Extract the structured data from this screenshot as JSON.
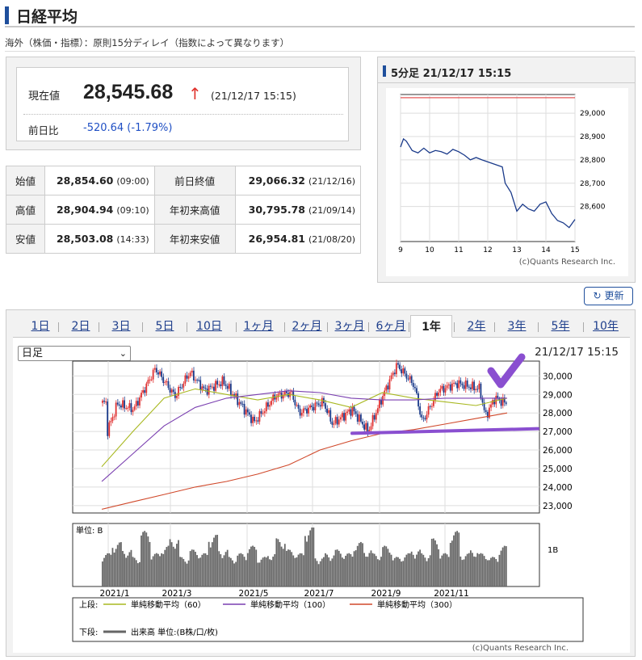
{
  "title": "日経平均",
  "note": "海外（株価・指標）：原則15分ディレイ（指数によって異なります）",
  "current": {
    "label": "現在値",
    "price": "28,545.68",
    "arrow": "↑",
    "time": "(21/12/17 15:15)",
    "change_label": "前日比",
    "change": "-520.64 (-1.79%)"
  },
  "ohlc": {
    "rows": [
      {
        "label": "始値",
        "value": "28,854.60",
        "time": "(09:00)",
        "label2": "前日終値",
        "value2": "29,066.32",
        "time2": "(21/12/16)"
      },
      {
        "label": "高値",
        "value": "28,904.94",
        "time": "(09:10)",
        "label2": "年初来高値",
        "value2": "30,795.78",
        "time2": "(21/09/14)"
      },
      {
        "label": "安値",
        "value": "28,503.08",
        "time": "(14:33)",
        "label2": "年初来安値",
        "value2": "26,954.81",
        "time2": "(21/08/20)"
      }
    ]
  },
  "intraday": {
    "header": "5分足 21/12/17 15:15",
    "copyright": "(c)Quants Research Inc."
  },
  "refresh_label": "更新",
  "tabs": [
    "1日",
    "2日",
    "3日",
    "5日",
    "10日",
    "1ヶ月",
    "2ヶ月",
    "3ヶ月",
    "6ヶ月",
    "1年",
    "2年",
    "3年",
    "5年",
    "10年"
  ],
  "active_tab": "1年",
  "daily": {
    "select_value": "日足",
    "datetime": "21/12/17 15:15",
    "volume_unit": "単位: B",
    "volume_tick": "1B",
    "legend": {
      "upper_label": "上段:",
      "lower_label": "下段:",
      "ma60": "単純移動平均（60）",
      "ma100": "単純移動平均（100）",
      "ma300": "単純移動平均（300）",
      "volume": "出来高 単位:(B株/口/枚)"
    },
    "copyright": "(c)Quants Research Inc."
  },
  "chart_data": [
    {
      "type": "line",
      "title": "5分足 21/12/17 15:15",
      "x_ticks": [
        "9",
        "10",
        "11",
        "12",
        "13",
        "14",
        "15"
      ],
      "y_ticks": [
        29000,
        28900,
        28800,
        28700,
        28600
      ],
      "ylim": [
        28450,
        29080
      ],
      "reference_line": 29066.32,
      "series": [
        {
          "x": [
            9.0,
            9.1,
            9.2,
            9.4,
            9.6,
            9.8,
            10.0,
            10.2,
            10.4,
            10.6,
            10.8,
            11.0,
            11.2,
            11.4,
            11.6,
            11.8,
            12.5,
            12.6,
            12.8,
            13.0,
            13.2,
            13.4,
            13.6,
            13.8,
            14.0,
            14.2,
            14.4,
            14.6,
            14.8,
            15.0
          ],
          "y": [
            28855,
            28890,
            28880,
            28840,
            28830,
            28850,
            28830,
            28840,
            28835,
            28825,
            28845,
            28835,
            28820,
            28800,
            28810,
            28800,
            28770,
            28700,
            28660,
            28580,
            28610,
            28590,
            28580,
            28610,
            28620,
            28570,
            28540,
            28530,
            28510,
            28545
          ]
        }
      ]
    },
    {
      "type": "candlestick",
      "title": "",
      "x_ticks": [
        "2021/1",
        "2021/3",
        "2021/5",
        "2021/7",
        "2021/9",
        "2021/11"
      ],
      "y_ticks": [
        30000,
        29000,
        28000,
        27000,
        26000,
        25000,
        24000,
        23000
      ],
      "ylim": [
        22600,
        30800
      ],
      "close_points": [
        {
          "date": "2021/1/4",
          "close": 26800
        },
        {
          "date": "2021/1/14",
          "close": 28500
        },
        {
          "date": "2021/1/28",
          "close": 28200
        },
        {
          "date": "2021/2/16",
          "close": 30400
        },
        {
          "date": "2021/3/5",
          "close": 28900
        },
        {
          "date": "2021/3/18",
          "close": 30200
        },
        {
          "date": "2021/3/31",
          "close": 29200
        },
        {
          "date": "2021/4/16",
          "close": 29700
        },
        {
          "date": "2021/5/13",
          "close": 27500
        },
        {
          "date": "2021/5/31",
          "close": 28900
        },
        {
          "date": "2021/6/14",
          "close": 29100
        },
        {
          "date": "2021/6/21",
          "close": 28000
        },
        {
          "date": "2021/7/12",
          "close": 28600
        },
        {
          "date": "2021/7/20",
          "close": 27400
        },
        {
          "date": "2021/8/6",
          "close": 28200
        },
        {
          "date": "2021/8/20",
          "close": 27000
        },
        {
          "date": "2021/9/3",
          "close": 29100
        },
        {
          "date": "2021/9/14",
          "close": 30600
        },
        {
          "date": "2021/9/29",
          "close": 29500
        },
        {
          "date": "2021/10/6",
          "close": 27500
        },
        {
          "date": "2021/10/20",
          "close": 29200
        },
        {
          "date": "2021/11/5",
          "close": 29600
        },
        {
          "date": "2021/11/25",
          "close": 29300
        },
        {
          "date": "2021/11/30",
          "close": 27800
        },
        {
          "date": "2021/12/8",
          "close": 28800
        },
        {
          "date": "2021/12/17",
          "close": 28545
        }
      ],
      "series": [
        {
          "name": "単純移動平均（60）",
          "color": "#a8b820",
          "values": [
            25100,
            27000,
            28800,
            29300,
            29000,
            28700,
            29000,
            28700,
            28300,
            29100,
            28800,
            28600,
            28400,
            28800
          ]
        },
        {
          "name": "単純移動平均（100）",
          "color": "#7a3fb0",
          "values": [
            24300,
            25800,
            27300,
            28300,
            28800,
            29000,
            29200,
            29100,
            28800,
            28700,
            28700,
            28800,
            28800,
            28800
          ]
        },
        {
          "name": "単純移動平均（300）",
          "color": "#d0482a",
          "values": [
            22800,
            23200,
            23600,
            24000,
            24300,
            24700,
            25200,
            26000,
            26500,
            26900,
            27100,
            27400,
            27700,
            28000
          ]
        }
      ]
    },
    {
      "type": "bar",
      "title": "",
      "y_ticks": [
        "1B"
      ],
      "x_ticks": [
        "2021/1",
        "2021/3",
        "2021/5",
        "2021/7",
        "2021/9",
        "2021/11"
      ],
      "values_B": [
        0.9,
        1.2,
        1.0,
        0.8,
        1.5,
        0.9,
        1.1,
        1.3,
        0.8,
        1.0,
        0.9,
        1.4,
        1.0,
        0.8,
        0.9,
        1.1,
        0.8,
        0.9,
        1.3,
        1.0,
        0.9,
        1.6,
        0.8,
        0.9,
        1.0,
        0.9,
        1.2,
        1.0,
        0.9,
        1.1,
        0.8,
        0.9,
        1.0,
        0.9,
        1.3,
        0.9,
        1.5,
        0.9,
        1.0,
        0.9,
        0.8,
        1.1
      ]
    }
  ]
}
